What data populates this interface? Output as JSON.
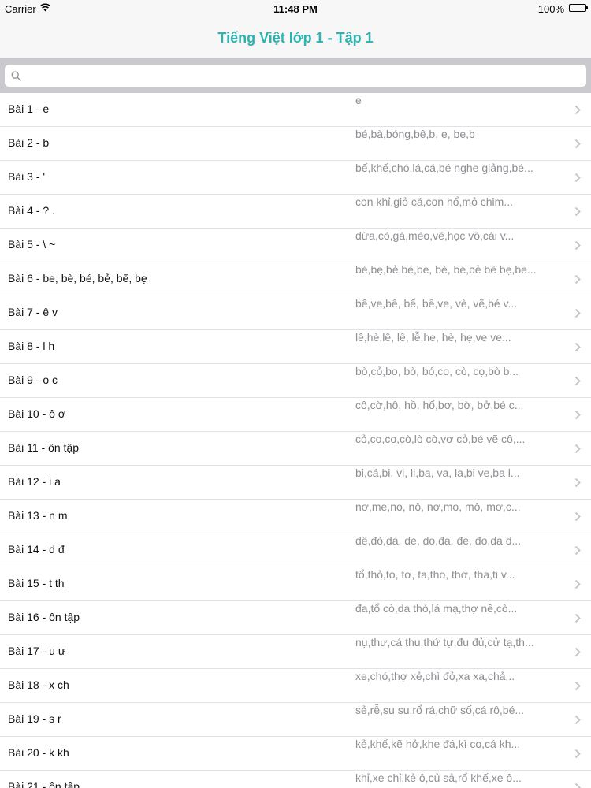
{
  "status_bar": {
    "carrier": "Carrier",
    "time": "11:48 PM",
    "battery": "100%"
  },
  "nav": {
    "title": "Tiếng Việt lớp 1 - Tập 1"
  },
  "search": {
    "placeholder": ""
  },
  "lessons": [
    {
      "title": "Bài 1 - e",
      "detail": "e"
    },
    {
      "title": "Bài 2 - b",
      "detail": "bé,bà,bóng,bê,b, e, be,b"
    },
    {
      "title": "Bài 3 - '",
      "detail": "bế,khế,chó,lá,cá,bé nghe giảng,bé..."
    },
    {
      "title": "Bài 4 - ? .",
      "detail": "con khỉ,giỏ cá,con hổ,mỏ chim..."
    },
    {
      "title": "Bài 5 - \\ ~",
      "detail": "dừa,cò,gà,mèo,vẽ,học võ,cái v..."
    },
    {
      "title": "Bài 6 - be, bè, bé, bẻ, bẽ, bẹ",
      "detail": "bé,bẹ,bẻ,bè,be, bè, bé,bẻ bẽ bẹ,be..."
    },
    {
      "title": "Bài 7 - ê v",
      "detail": "bê,ve,bê, bể, bế,ve, vè, vẽ,bé v..."
    },
    {
      "title": "Bài 8 - l h",
      "detail": "lê,hè,lê, lề, lễ,he, hè, hẹ,ve ve..."
    },
    {
      "title": "Bài 9 - o c",
      "detail": "bò,cỏ,bo, bò, bó,co, cò, cọ,bò b..."
    },
    {
      "title": "Bài 10 - ô ơ",
      "detail": "cô,cờ,hô, hồ, hổ,bơ, bờ, bở,bé c..."
    },
    {
      "title": "Bài 11 - ôn tập",
      "detail": "cỏ,cọ,co,cò,lò cò,vơ cỏ,bé vẽ cô,..."
    },
    {
      "title": "Bài 12 - i a",
      "detail": "bi,cá,bi, vi, li,ba, va, la,bi ve,ba l..."
    },
    {
      "title": "Bài 13 - n m",
      "detail": "nơ,me,no, nô, nơ,mo, mô, mơ,c..."
    },
    {
      "title": "Bài 14 - d đ",
      "detail": "dê,đò,da, de, do,đa, đe, đo,da d..."
    },
    {
      "title": "Bài 15 - t th",
      "detail": "tổ,thỏ,to, tơ, ta,tho, thơ, tha,ti v..."
    },
    {
      "title": "Bài 16 - ôn tập",
      "detail": "đa,tổ cò,da thỏ,lá mạ,thợ nề,cò..."
    },
    {
      "title": "Bài 17 - u ư",
      "detail": "nụ,thư,cá thu,thứ tự,đu đủ,cử tạ,th..."
    },
    {
      "title": "Bài 18 - x ch",
      "detail": "xe,chó,thợ xẻ,chì đỏ,xa xa,chả..."
    },
    {
      "title": "Bài 19 - s r",
      "detail": "sẻ,rễ,su su,rổ rá,chữ số,cá rô,bé..."
    },
    {
      "title": "Bài 20 - k kh",
      "detail": "kẻ,khế,kẽ hở,khe đá,kì cọ,cá kh..."
    },
    {
      "title": "Bài 21 - ôn tập",
      "detail": "khỉ,xe chỉ,kẻ ô,củ sả,rổ khế,xe ô..."
    }
  ]
}
